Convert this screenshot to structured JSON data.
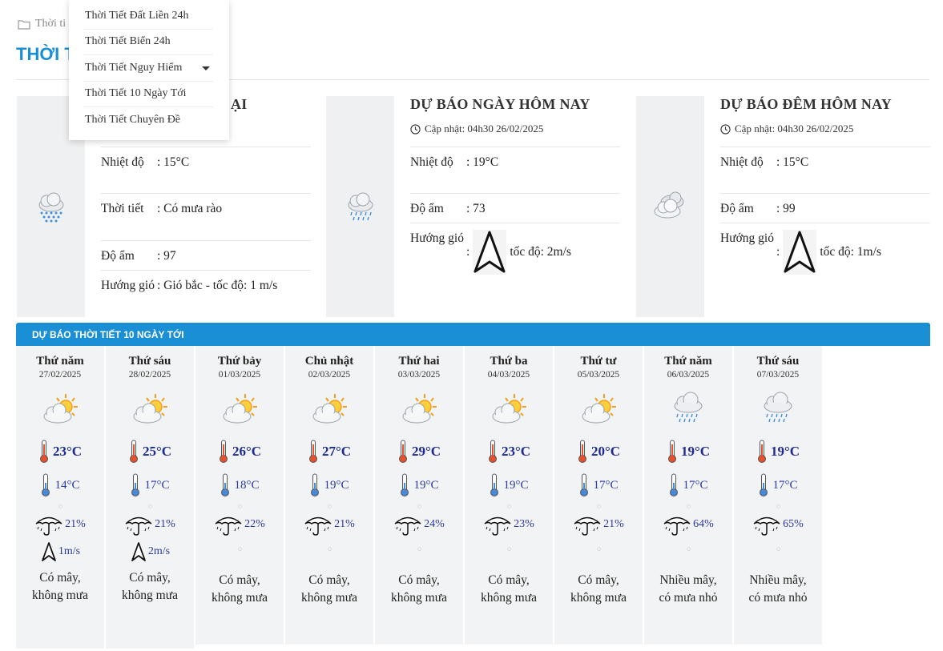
{
  "breadcrumb": {
    "label": "Thời ti"
  },
  "page": {
    "title": "THỜI T"
  },
  "menu": {
    "items": [
      {
        "label": "Thời Tiết Đất Liền 24h"
      },
      {
        "label": "Thời Tiết Biển 24h"
      },
      {
        "label": "Thời Tiết Nguy Hiểm"
      },
      {
        "label": "Thời Tiết 10 Ngày Tới"
      },
      {
        "label": "Thời Tiết Chuyên Đề"
      }
    ]
  },
  "current": {
    "title": "ẠI",
    "rows": {
      "temp": {
        "label": "Nhiệt độ",
        "value": ": 15°C"
      },
      "weather": {
        "label": "Thời tiết",
        "value": ": Có mưa rào"
      },
      "humidity": {
        "label": "Độ ẩm",
        "value": ": 97"
      },
      "wind": {
        "label": "Hướng gió",
        "value": ": Gió bắc - tốc độ: 1 m/s"
      }
    }
  },
  "today": {
    "title": "DỰ BÁO NGÀY HÔM NAY",
    "update": "Cập nhật: 04h30 26/02/2025",
    "temp": {
      "label": "Nhiệt độ",
      "value": ": 19°C"
    },
    "humidity": {
      "label": "Độ ẩm",
      "value": ": 73"
    },
    "wind": {
      "label": "Hướng gió",
      "prefix": ":",
      "value": "tốc độ: 2m/s"
    }
  },
  "tonight": {
    "title": "DỰ BÁO ĐÊM HÔM NAY",
    "update": "Cập nhật: 04h30 26/02/2025",
    "temp": {
      "label": "Nhiệt độ",
      "value": ": 15°C"
    },
    "humidity": {
      "label": "Độ ẩm",
      "value": ": 99"
    },
    "wind": {
      "label": "Hướng gió",
      "prefix": ":",
      "value": "tốc độ: 1m/s"
    }
  },
  "forecast": {
    "title": "DỰ BÁO THỜI TIẾT 10 NGÀY TỚI",
    "days": [
      {
        "name": "Thứ năm",
        "date": "27/02/2025",
        "icon": "partly-cloudy-sun-icon",
        "max": "23°C",
        "min": "14°C",
        "rain": "21%",
        "wind": "1m/s",
        "desc1": "Có mây,",
        "desc2": "không mưa"
      },
      {
        "name": "Thứ sáu",
        "date": "28/02/2025",
        "icon": "partly-cloudy-sun-icon",
        "max": "25°C",
        "min": "17°C",
        "rain": "21%",
        "wind": "2m/s",
        "desc1": "Có mây,",
        "desc2": "không mưa"
      },
      {
        "name": "Thứ bảy",
        "date": "01/03/2025",
        "icon": "partly-cloudy-sun-icon",
        "max": "26°C",
        "min": "18°C",
        "rain": "22%",
        "wind": "",
        "desc1": "Có mây,",
        "desc2": "không mưa"
      },
      {
        "name": "Chủ nhật",
        "date": "02/03/2025",
        "icon": "partly-cloudy-sun-icon",
        "max": "27°C",
        "min": "19°C",
        "rain": "21%",
        "wind": "",
        "desc1": "Có mây,",
        "desc2": "không mưa"
      },
      {
        "name": "Thứ hai",
        "date": "03/03/2025",
        "icon": "partly-cloudy-sun-icon",
        "max": "29°C",
        "min": "19°C",
        "rain": "24%",
        "wind": "",
        "desc1": "Có mây,",
        "desc2": "không mưa"
      },
      {
        "name": "Thứ ba",
        "date": "04/03/2025",
        "icon": "partly-cloudy-sun-icon",
        "max": "23°C",
        "min": "19°C",
        "rain": "23%",
        "wind": "",
        "desc1": "Có mây,",
        "desc2": "không mưa"
      },
      {
        "name": "Thứ tư",
        "date": "05/03/2025",
        "icon": "partly-cloudy-sun-icon",
        "max": "20°C",
        "min": "17°C",
        "rain": "21%",
        "wind": "",
        "desc1": "Có mây,",
        "desc2": "không mưa"
      },
      {
        "name": "Thứ năm",
        "date": "06/03/2025",
        "icon": "rain-cloud-icon",
        "max": "19°C",
        "min": "17°C",
        "rain": "64%",
        "wind": "",
        "desc1": "Nhiều mây,",
        "desc2": "có mưa nhỏ"
      },
      {
        "name": "Thứ sáu",
        "date": "07/03/2025",
        "icon": "rain-cloud-icon",
        "max": "19°C",
        "min": "17°C",
        "rain": "65%",
        "wind": "",
        "desc1": "Nhiều mây,",
        "desc2": "có mưa nhỏ"
      }
    ]
  },
  "colors": {
    "accent": "#1a8fd6",
    "temp_text": "#1d2a8f",
    "panel_bg": "#eff0f1",
    "day_bg": "#f2f3f4"
  }
}
